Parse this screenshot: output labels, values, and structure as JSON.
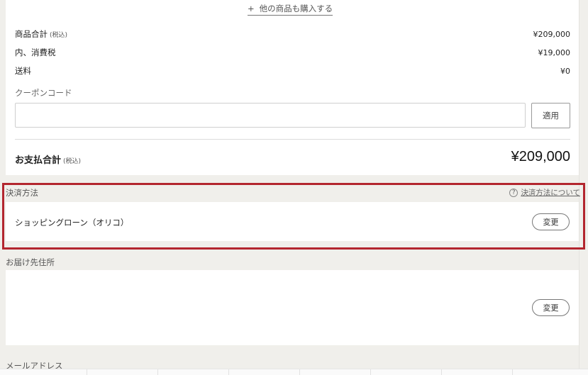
{
  "summary": {
    "add_more_link": "他の商品も購入する",
    "add_more_icon": "+",
    "rows": [
      {
        "label": "商品合計",
        "sub": "(税込)",
        "value": "¥209,000"
      },
      {
        "label": "内、消費税",
        "sub": "",
        "value": "¥19,000"
      },
      {
        "label": "送料",
        "sub": "",
        "value": "¥0"
      }
    ],
    "coupon_label": "クーポンコード",
    "coupon_value": "",
    "coupon_placeholder": "",
    "apply_label": "適用",
    "total_label": "お支払合計",
    "total_sub": "(税込)",
    "total_value": "¥209,000"
  },
  "payment": {
    "section_label": "決済方法",
    "help_icon": "?",
    "help_link": "決済方法について",
    "method": "ショッピングローン（オリコ）",
    "change_label": "変更"
  },
  "address": {
    "section_label": "お届け先住所",
    "change_label": "変更"
  },
  "email": {
    "section_label": "メールアドレス"
  },
  "colors": {
    "highlight_border": "#b3262f",
    "page_background": "#f0efeb",
    "card_background": "#ffffff"
  }
}
